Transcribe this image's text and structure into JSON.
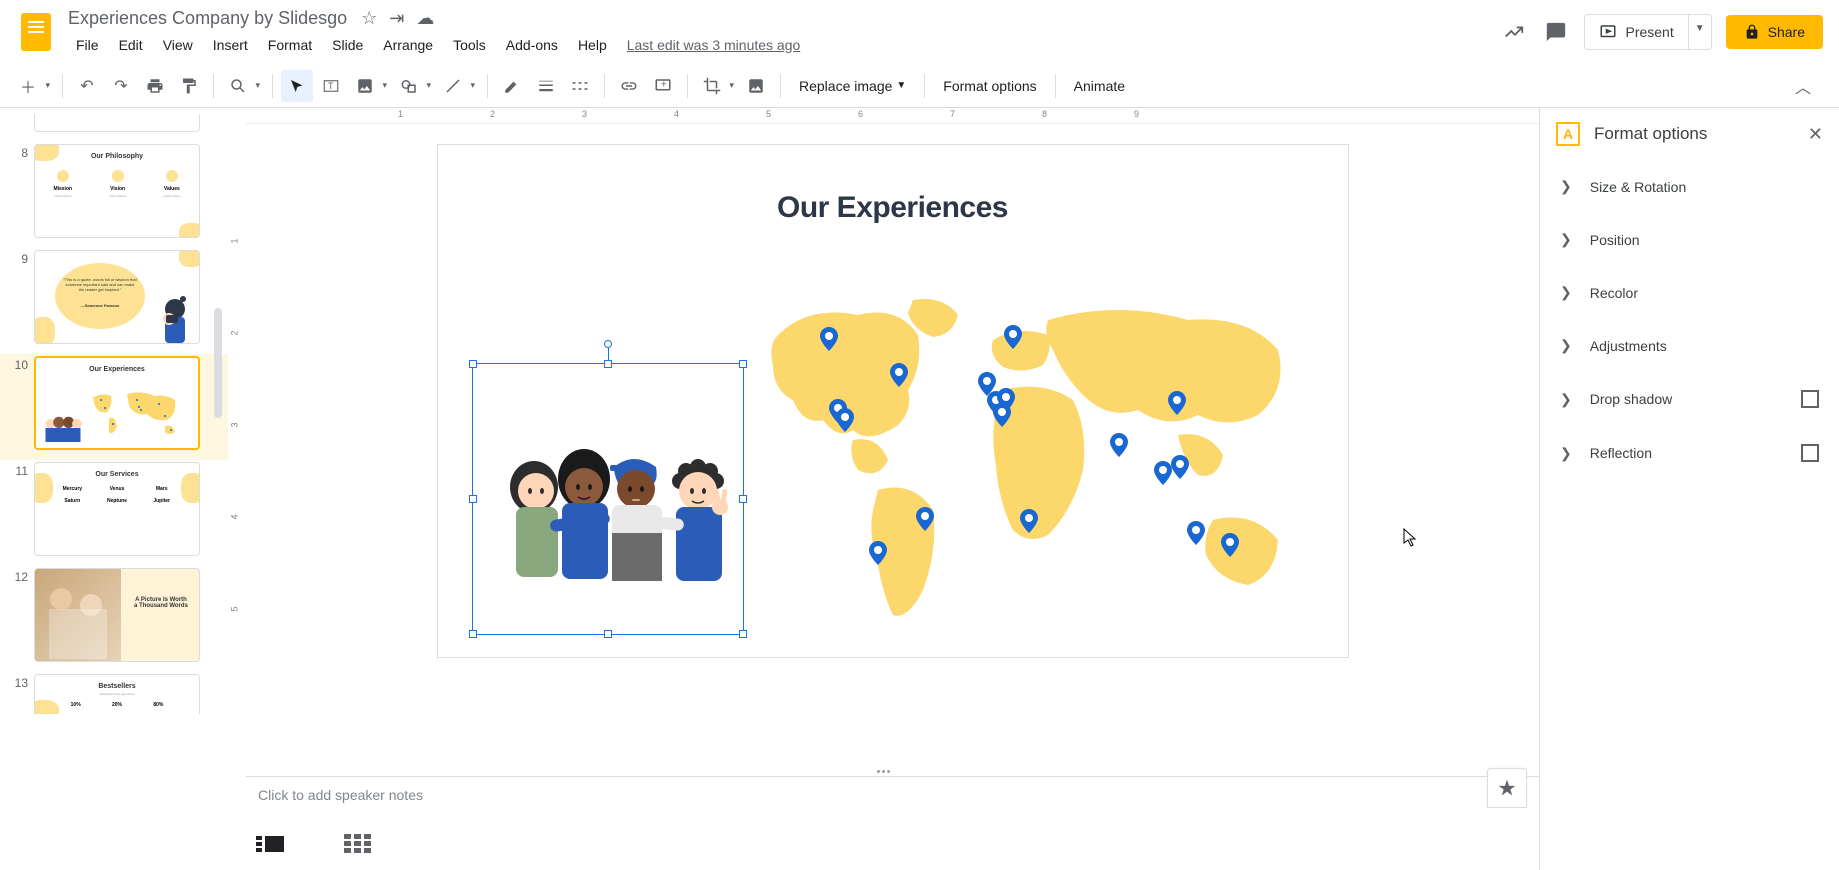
{
  "document": {
    "title": "Experiences Company by Slidesgo",
    "last_edit": "Last edit was 3 minutes ago"
  },
  "menubar": {
    "file": "File",
    "edit": "Edit",
    "view": "View",
    "insert": "Insert",
    "format": "Format",
    "slide": "Slide",
    "arrange": "Arrange",
    "tools": "Tools",
    "addons": "Add-ons",
    "help": "Help"
  },
  "header_actions": {
    "present": "Present",
    "share": "Share"
  },
  "toolbar": {
    "replace_image": "Replace image",
    "format_options": "Format options",
    "animate": "Animate"
  },
  "ruler_h": [
    "1",
    "2",
    "3",
    "4",
    "5",
    "6",
    "7",
    "8",
    "9"
  ],
  "ruler_v": [
    "1",
    "2",
    "3",
    "4",
    "5"
  ],
  "thumbnails": [
    {
      "num": "8",
      "title": "Our Philosophy",
      "subtitles": [
        "Mission",
        "Vision",
        "Values"
      ],
      "selected": false
    },
    {
      "num": "9",
      "title": "",
      "quote": "\"This is a quote, words full of wisdom that someone important said and can make the reader get inspired.\"",
      "author": "—Someone Famous",
      "selected": false
    },
    {
      "num": "10",
      "title": "Our Experiences",
      "selected": true
    },
    {
      "num": "11",
      "title": "Our Services",
      "items": [
        "Mercury",
        "Venus",
        "Mars",
        "Saturn",
        "Neptune",
        "Jupiter"
      ],
      "selected": false
    },
    {
      "num": "12",
      "title": "A Picture Is Worth a Thousand Words",
      "selected": false
    },
    {
      "num": "13",
      "title": "Bestsellers",
      "percents": [
        "10%",
        "20%",
        "80%"
      ],
      "selected": false
    }
  ],
  "slide": {
    "title": "Our Experiences"
  },
  "speaker_notes": {
    "placeholder": "Click to add speaker notes"
  },
  "sidebar": {
    "title": "Format options",
    "items": [
      {
        "label": "Size & Rotation",
        "checkbox": false
      },
      {
        "label": "Position",
        "checkbox": false
      },
      {
        "label": "Recolor",
        "checkbox": false
      },
      {
        "label": "Adjustments",
        "checkbox": false
      },
      {
        "label": "Drop shadow",
        "checkbox": true
      },
      {
        "label": "Reflection",
        "checkbox": true
      }
    ]
  },
  "colors": {
    "accent": "#ffba00",
    "map": "#fbd76c",
    "pin": "#1967d2"
  }
}
